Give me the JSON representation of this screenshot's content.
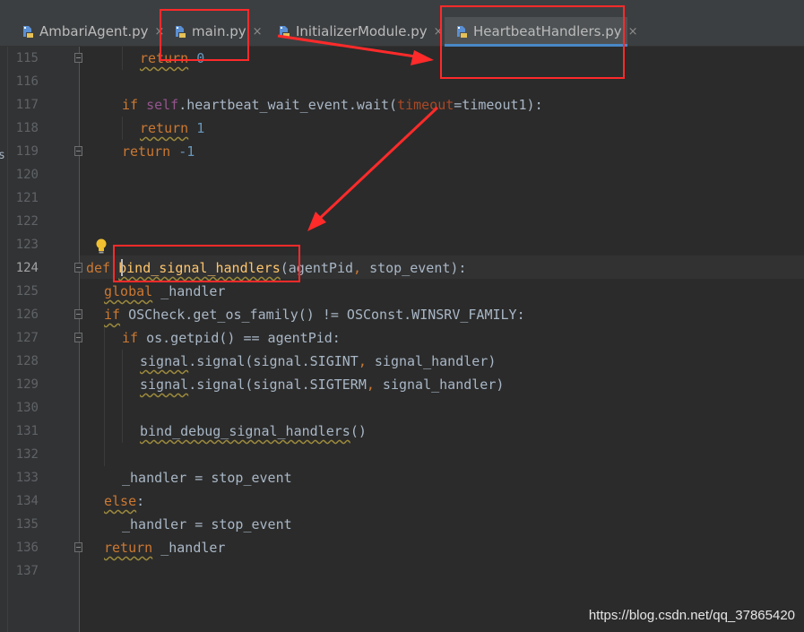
{
  "tabs": [
    {
      "label": "AmbariAgent.py",
      "icon": "python-file-icon",
      "active": false
    },
    {
      "label": "main.py",
      "icon": "python-file-icon",
      "active": false
    },
    {
      "label": "InitializerModule.py",
      "icon": "python-file-icon",
      "active": false
    },
    {
      "label": "HeartbeatHandlers.py",
      "icon": "python-file-icon",
      "active": true
    }
  ],
  "tab_close_glyph": "×",
  "left_edge_fragment": "s",
  "editor": {
    "current_line": "124",
    "lines": [
      {
        "n": "115",
        "text": "return 0"
      },
      {
        "n": "116",
        "text": ""
      },
      {
        "n": "117",
        "text": "if self.heartbeat_wait_event.wait(timeout=timeout1):"
      },
      {
        "n": "118",
        "text": "return 1"
      },
      {
        "n": "119",
        "text": "return -1"
      },
      {
        "n": "120",
        "text": ""
      },
      {
        "n": "121",
        "text": ""
      },
      {
        "n": "122",
        "text": ""
      },
      {
        "n": "123",
        "text": ""
      },
      {
        "n": "124",
        "text": "def bind_signal_handlers(agentPid, stop_event):"
      },
      {
        "n": "125",
        "text": "global _handler"
      },
      {
        "n": "126",
        "text": "if OSCheck.get_os_family() != OSConst.WINSRV_FAMILY:"
      },
      {
        "n": "127",
        "text": "if os.getpid() == agentPid:"
      },
      {
        "n": "128",
        "text": "signal.signal(signal.SIGINT, signal_handler)"
      },
      {
        "n": "129",
        "text": "signal.signal(signal.SIGTERM, signal_handler)"
      },
      {
        "n": "130",
        "text": ""
      },
      {
        "n": "131",
        "text": "bind_debug_signal_handlers()"
      },
      {
        "n": "132",
        "text": ""
      },
      {
        "n": "133",
        "text": "_handler = stop_event"
      },
      {
        "n": "134",
        "text": "else:"
      },
      {
        "n": "135",
        "text": "_handler = stop_event"
      },
      {
        "n": "136",
        "text": "return _handler"
      },
      {
        "n": "137",
        "text": ""
      }
    ],
    "tokens": {
      "l115_kw": "return",
      "l115_num": "0",
      "l117_kw": "if",
      "l117_self": "self",
      "l117_a": ".heartbeat_wait_event.wait(",
      "l117_param": "timeout",
      "l117_b": "=timeout1):",
      "l118_kw": "return",
      "l118_num": "1",
      "l119_kw": "return",
      "l119_num": "-1",
      "l124_kw": "def",
      "l124_fn": "bind_signal_handlers",
      "l124_a": "(agentPid",
      "l124_comma": ",",
      "l124_b": " stop_event):",
      "l125_kw": "global",
      "l125_a": " _handler",
      "l126_kw": "if",
      "l126_a": " OSCheck.get_os_family() != OSConst.WINSRV_FAMILY:",
      "l127_kw": "if",
      "l127_a": " os.getpid() == agentPid:",
      "l128_a": "signal",
      "l128_b": ".signal(signal.SIGINT",
      "l128_comma": ",",
      "l128_c": " signal_handler)",
      "l129_a": "signal",
      "l129_b": ".signal(signal.SIGTERM",
      "l129_comma": ",",
      "l129_c": " signal_handler)",
      "l131_a": "bind_debug_signal_handlers",
      "l131_b": "()",
      "l133_a": "_handler = stop_event",
      "l134_kw": "else",
      "l134_a": ":",
      "l135_a": "_handler = stop_event",
      "l136_kw": "return",
      "l136_a": " _handler"
    }
  },
  "watermark": "https://blog.csdn.net/qq_37865420",
  "colors": {
    "annotation": "#ff2a2a",
    "keyword": "#cc7832",
    "function": "#ffc66d",
    "number": "#6897bb",
    "self": "#94558d",
    "param": "#aa4926",
    "text": "#a9b7c6",
    "active_tab_underline": "#4a88c7"
  }
}
